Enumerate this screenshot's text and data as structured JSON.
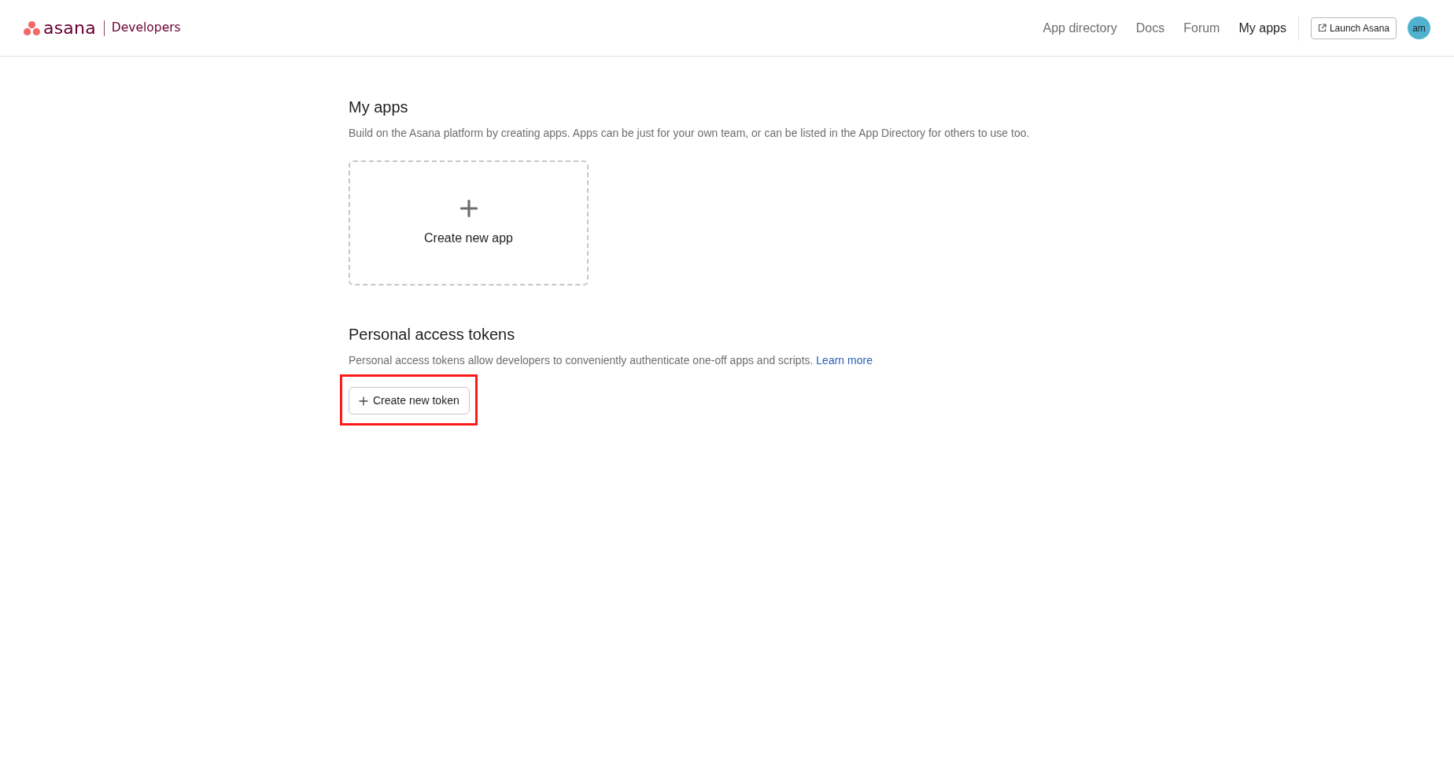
{
  "header": {
    "logo": {
      "wordmark": "asana",
      "product": "Developers"
    },
    "nav": [
      {
        "label": "App directory",
        "selected": false
      },
      {
        "label": "Docs",
        "selected": false
      },
      {
        "label": "Forum",
        "selected": false
      },
      {
        "label": "My apps",
        "selected": true
      }
    ],
    "launch_button": {
      "label": "Launch Asana"
    },
    "avatar": {
      "initials": "am"
    }
  },
  "my_apps": {
    "title": "My apps",
    "description": "Build on the Asana platform by creating apps. Apps can be just for your own team, or can be listed in the App Directory for others to use too.",
    "card": {
      "label": "Create new app"
    }
  },
  "personal_access_tokens": {
    "title": "Personal access tokens",
    "description": "Personal access tokens allow developers to conveniently authenticate one-off apps and scripts.",
    "link": "Learn more",
    "button": {
      "label": "Create new token",
      "highlighted": true
    }
  }
}
